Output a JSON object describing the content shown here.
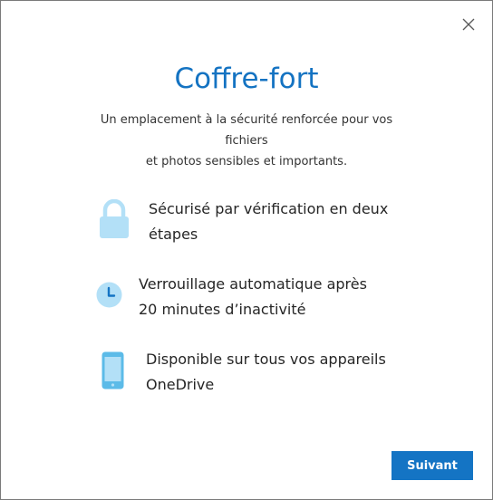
{
  "dialog": {
    "title": "Coffre-fort",
    "subtitle_line1": "Un emplacement à la sécurité renforcée pour vos fichiers",
    "subtitle_line2": "et photos sensibles et importants.",
    "close_icon": "close-icon",
    "features": [
      {
        "icon": "lock-icon",
        "line1": "Sécurisé par vérification en deux",
        "line2": "étapes"
      },
      {
        "icon": "clock-icon",
        "line1": "Verrouillage automatique après",
        "line2": "20 minutes d’inactivité"
      },
      {
        "icon": "phone-icon",
        "line1": "Disponible sur tous vos appareils",
        "line2": "OneDrive"
      }
    ],
    "next_label": "Suivant"
  },
  "colors": {
    "accent": "#1474c4",
    "title": "#1473c2",
    "icon_light": "#b3e0f7",
    "icon_mid": "#5cbbe8"
  }
}
